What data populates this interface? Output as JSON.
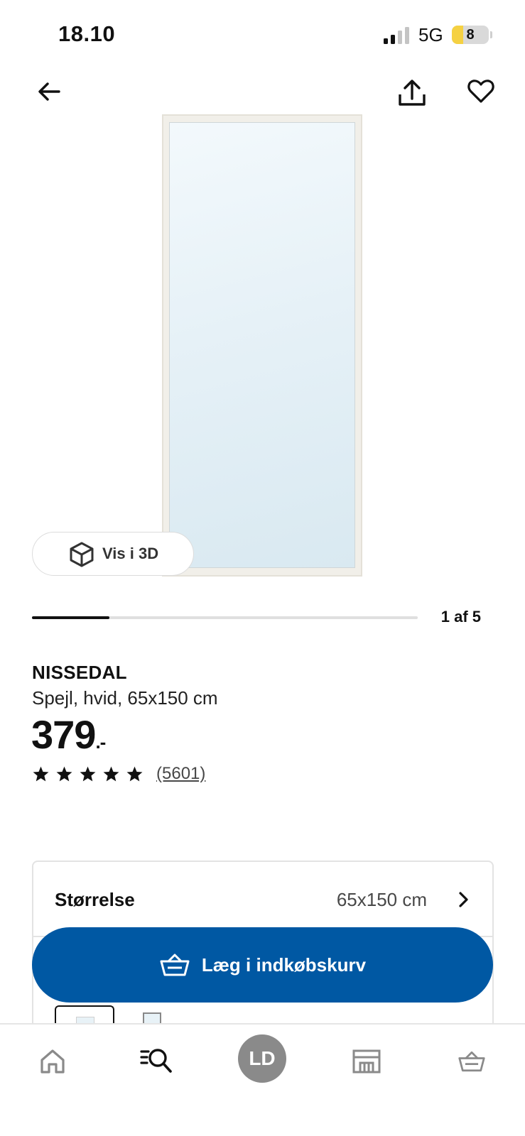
{
  "status_bar": {
    "time": "18.10",
    "network": "5G",
    "battery_level": "8",
    "battery_fraction": 0.08
  },
  "nav": {
    "back_icon": "arrow-left-icon",
    "share_icon": "share-upload-icon",
    "favorite_icon": "heart-icon"
  },
  "gallery": {
    "view_3d_label": "Vis i 3D",
    "view_3d_icon": "cube-3d-icon",
    "position_text": "1 af 5",
    "current_index": 1,
    "total_images": 5
  },
  "product": {
    "name": "NISSEDAL",
    "description": "Spejl, hvid, 65x150 cm",
    "price": "379",
    "price_suffix": ".-",
    "rating_stars": 5,
    "review_count": "(5601)"
  },
  "options": {
    "size_label": "Størrelse",
    "size_value": "65x150 cm"
  },
  "cart_button": {
    "label": "Læg i indkøbskurv",
    "icon": "basket-icon",
    "color": "#0058a3"
  },
  "bottom_nav": {
    "home_icon": "home-icon",
    "search_icon": "search-list-icon",
    "profile_initials": "LD",
    "stores_icon": "store-icon",
    "cart_icon": "basket-icon"
  }
}
